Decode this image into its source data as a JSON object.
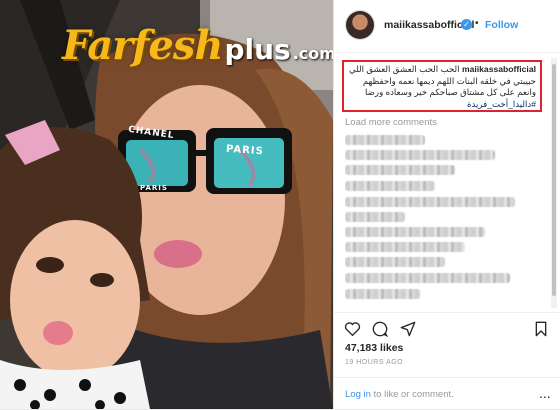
{
  "watermark": {
    "part1": "Farfesh",
    "part2": "plus",
    "part3": ".com"
  },
  "photo": {
    "glasses_brand": "CHANEL",
    "lens_text": "PARIS",
    "lens_text_small": "PARIS"
  },
  "header": {
    "username": "maiikassabofficial",
    "separator": "•",
    "follow_label": "Follow"
  },
  "caption": {
    "username": "maiikassabofficial",
    "text": " الحب الحب العشق العشق اللي حبيبتي في خلقه البنات اللهم ديمها نعمه واحفظهم وانعم على كل مشتاق صباحكم خير وسعاده ورضا ",
    "hashtag": "#داليدا_أخت_فريدة",
    "emoji": "❤□□□□"
  },
  "load_more": "Load more comments",
  "likes": "47,183 likes",
  "timestamp": "19 HOURS AGO",
  "comment_box": {
    "login_label": "Log in",
    "rest": " to like or comment.",
    "more_icon": "..."
  },
  "colors": {
    "accent": "#3897f0",
    "highlight": "#e0232b",
    "watermark": "#f6b81a"
  }
}
